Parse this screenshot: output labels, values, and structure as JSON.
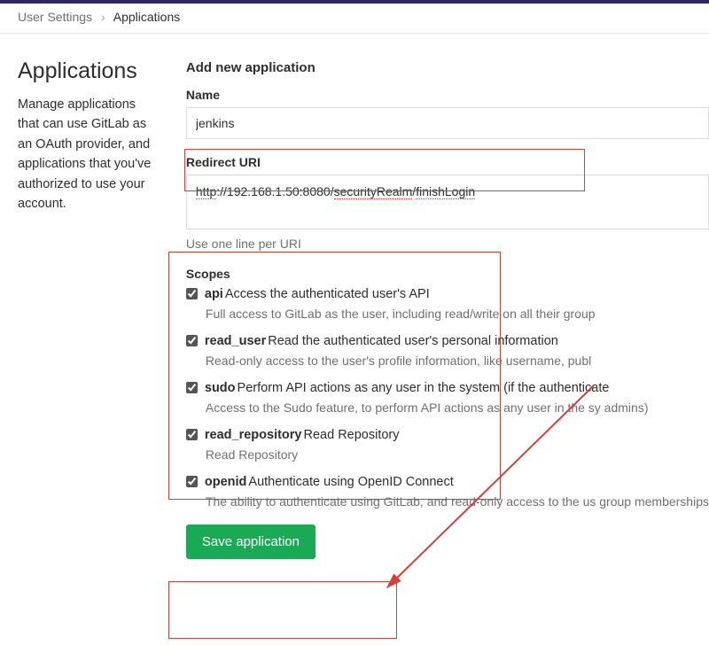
{
  "breadcrumb": {
    "parent": "User Settings",
    "separator": "›",
    "current": "Applications"
  },
  "left": {
    "heading": "Applications",
    "description": "Manage applications that can use GitLab as an OAuth provider, and applications that you've authorized to use your account."
  },
  "form": {
    "title": "Add new application",
    "name_label": "Name",
    "name_value": "jenkins",
    "redirect_label": "Redirect URI",
    "redirect_value_parts": {
      "p1": "http",
      "p2": "://192.168.1.50:8080/",
      "p3": "securityRealm",
      "p4": "/",
      "p5": "finishLogin"
    },
    "redirect_help": "Use one line per URI",
    "scopes_label": "Scopes",
    "scopes": [
      {
        "id": "api",
        "checked": true,
        "name": "api",
        "label": "Access the authenticated user's API",
        "desc": "Full access to GitLab as the user, including read/write on all their group"
      },
      {
        "id": "read_user",
        "checked": true,
        "name": "read_user",
        "label": "Read the authenticated user's personal information",
        "desc": "Read-only access to the user's profile information, like username, publ"
      },
      {
        "id": "sudo",
        "checked": true,
        "name": "sudo",
        "label": "Perform API actions as any user in the system (if the authenticate",
        "desc": "Access to the Sudo feature, to perform API actions as any user in the sy admins)"
      },
      {
        "id": "read_repository",
        "checked": true,
        "name": "read_repository",
        "label": "Read Repository",
        "desc": "Read Repository"
      },
      {
        "id": "openid",
        "checked": true,
        "name": "openid",
        "label": "Authenticate using OpenID Connect",
        "desc": "The ability to authenticate using GitLab, and read-only access to the us group memberships"
      }
    ],
    "save_label": "Save application"
  }
}
